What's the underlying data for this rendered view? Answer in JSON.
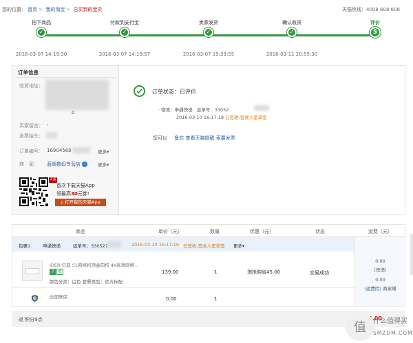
{
  "breadcrumb": {
    "prefix": "您的位置：",
    "home": "首页",
    "mytmall": "我的淘宝",
    "current": "已买到的宝贝"
  },
  "hotline": "天猫热线：4008 608 608",
  "progress": {
    "steps": [
      {
        "label": "拍下商品",
        "dot": "✓",
        "time": "2016-03-07 14:19:30"
      },
      {
        "label": "付款到支付宝",
        "dot": "✓",
        "time": "2016-03-07 14:19:57"
      },
      {
        "label": "卖家发货",
        "dot": "✓",
        "time": "2016-03-07 19:39:55"
      },
      {
        "label": "确认收货",
        "dot": "✓",
        "time": "2016-03-11 20:55:30"
      },
      {
        "label": "评价",
        "dot": "5",
        "time": ""
      }
    ]
  },
  "order_info": {
    "title": "订单信息",
    "address_key": "收货地址：",
    "address_tail": "0",
    "buyer_note_key": "买家留言：",
    "buyer_note_val": "-",
    "invoice_key": "发票抬头：",
    "order_no_key": "订单编号：",
    "order_no_val": "16904568",
    "order_more": "更多",
    "shop_key": "商　家：",
    "shop_val": "蓝崎数码专营店",
    "shop_more": "更多",
    "app_promo_line1": "首次下载天猫App",
    "app_promo_line2_a": "领最高",
    "app_promo_line2_b": "30",
    "app_promo_line2_c": "元券!",
    "tmall_badge": "天猫",
    "app_button": "打开我的天猫App"
  },
  "status": {
    "text": "订单状态：已评价",
    "logistics_prefix": "· 物流：",
    "logistics_company": "申通快递",
    "tracking_key": "运单号：",
    "tracking_no": "33052",
    "logistics_time": "2016-03-10 16:17:19",
    "logistics_sign": "已签收,签收人是草签",
    "ops_prefix": "您可以",
    "ops": [
      "备忘",
      "查看天猫提醒",
      "索要发票"
    ]
  },
  "table": {
    "headers": {
      "product": "商品",
      "price": "单价（元）",
      "qty": "数量",
      "discount": "优惠（元）",
      "state": "状态",
      "shipping": "运费（元）"
    },
    "package": {
      "label": "包裹1",
      "company": "申通快递",
      "tracking": "运单号：330527",
      "time": "2016-03-10 16:17:19",
      "sign": "已签收,签收人是草签",
      "more": "更多"
    },
    "item": {
      "title": "IDER/亿典 S1网络机顶盒四核 4K高清网络...",
      "tag1": "7",
      "tag2": "退",
      "attr": "颜色分类：白色  套餐类型：官方标配",
      "price": "139.00",
      "qty": "1",
      "discount": "淘抢购省45.00",
      "state": "交易成功"
    },
    "shipping": {
      "v1": "0.00",
      "v2": "（快递）",
      "v3": "0.00",
      "v4": "(运费险)",
      "v5": "商家赠"
    },
    "insurance": {
      "title": "全国联保",
      "price": "0.00",
      "qty": "1"
    }
  },
  "footer": {
    "points": "返 积分9点",
    "total": "¥94.00"
  },
  "watermark": {
    "glyph": "值",
    "line1": "什么值得买",
    "line2": "SMZDM.COM"
  }
}
